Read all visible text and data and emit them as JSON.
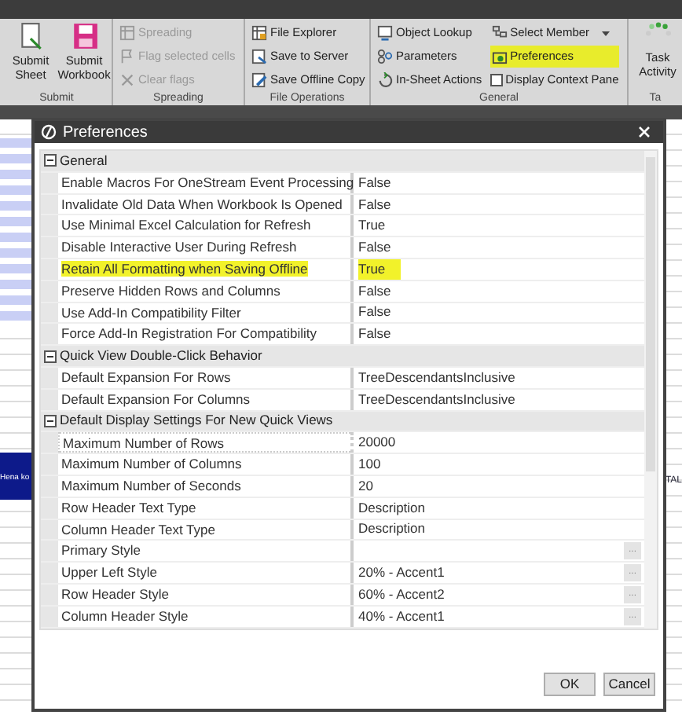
{
  "ribbon": {
    "groups": [
      {
        "label": "Submit",
        "kind": "large",
        "items": [
          {
            "label": "Submit Sheet",
            "disabled": false
          },
          {
            "label": "Submit Workbook",
            "disabled": false
          }
        ]
      },
      {
        "label": "Spreading",
        "kind": "small",
        "items": [
          {
            "label": "Spreading",
            "disabled": true
          },
          {
            "label": "Flag selected cells",
            "disabled": true
          },
          {
            "label": "Clear flags",
            "disabled": true
          }
        ]
      },
      {
        "label": "File Operations",
        "kind": "small",
        "items": [
          {
            "label": "File Explorer",
            "disabled": false
          },
          {
            "label": "Save to Server",
            "disabled": false
          },
          {
            "label": "Save Offline Copy",
            "disabled": false
          }
        ]
      },
      {
        "label": "General",
        "kind": "columns",
        "columns": [
          [
            {
              "label": "Object Lookup",
              "kind": "button",
              "highlighted": false
            },
            {
              "label": "Parameters",
              "kind": "button",
              "highlighted": false
            },
            {
              "label": "In-Sheet Actions",
              "kind": "button",
              "highlighted": false
            }
          ],
          [
            {
              "label": "Select Member",
              "kind": "dropdown",
              "highlighted": false
            },
            {
              "label": "Preferences",
              "kind": "button",
              "highlighted": true
            },
            {
              "label": "Display Context Pane",
              "kind": "checkbox",
              "checked": false
            }
          ]
        ]
      },
      {
        "label": "Ta",
        "kind": "large",
        "items": [
          {
            "label": "Task Activity",
            "disabled": false
          }
        ]
      }
    ]
  },
  "sheet": {
    "left_text": "Hena ko",
    "right_text": "TAL"
  },
  "dialog": {
    "title": "Preferences",
    "rows": [
      {
        "kind": "category",
        "label": "General",
        "expanded": true
      },
      {
        "kind": "property",
        "name": "Enable Macros For OneStream Event Processing",
        "value": "False",
        "highlighted": false
      },
      {
        "kind": "property",
        "name": "Invalidate Old Data When Workbook Is Opened",
        "value": "False",
        "highlighted": false
      },
      {
        "kind": "property",
        "name": "Use Minimal Excel Calculation for Refresh",
        "value": "True",
        "highlighted": false
      },
      {
        "kind": "property",
        "name": "Disable Interactive User During Refresh",
        "value": "False",
        "highlighted": false
      },
      {
        "kind": "property",
        "name": "Retain All Formatting when Saving Offline",
        "value": "True",
        "highlighted": true
      },
      {
        "kind": "property",
        "name": "Preserve Hidden Rows and Columns",
        "value": "False",
        "highlighted": false
      },
      {
        "kind": "property",
        "name": "Use Add-In Compatibility Filter",
        "value": "False",
        "highlighted": false
      },
      {
        "kind": "property",
        "name": "Force Add-In Registration For Compatibility",
        "value": "False",
        "highlighted": false
      },
      {
        "kind": "category",
        "label": "Quick View Double-Click Behavior",
        "expanded": true
      },
      {
        "kind": "property",
        "name": "Default Expansion For Rows",
        "value": "TreeDescendantsInclusive",
        "highlighted": false
      },
      {
        "kind": "property",
        "name": "Default Expansion For Columns",
        "value": "TreeDescendantsInclusive",
        "highlighted": false
      },
      {
        "kind": "category",
        "label": "Default Display Settings For New Quick Views",
        "expanded": true
      },
      {
        "kind": "property",
        "name": "Maximum Number of Rows",
        "value": "20000",
        "highlighted": false,
        "focused": true
      },
      {
        "kind": "property",
        "name": "Maximum Number of Columns",
        "value": "100",
        "highlighted": false
      },
      {
        "kind": "property",
        "name": "Maximum Number of Seconds",
        "value": "20",
        "highlighted": false
      },
      {
        "kind": "property",
        "name": "Row Header Text Type",
        "value": "Description",
        "highlighted": false
      },
      {
        "kind": "property",
        "name": "Column Header Text Type",
        "value": "Description",
        "highlighted": false
      },
      {
        "kind": "property",
        "name": "Primary Style",
        "button": "...",
        "highlighted": false
      },
      {
        "kind": "property",
        "name": "Upper Left Style",
        "value": "20% - Accent1",
        "button": "...",
        "highlighted": false
      },
      {
        "kind": "property",
        "name": "Row Header Style",
        "value": "60% - Accent2",
        "button": "...",
        "highlighted": false
      },
      {
        "kind": "property",
        "name": "Column Header Style",
        "value": "40% - Accent1",
        "button": "...",
        "highlighted": false
      }
    ],
    "buttons": [
      "OK",
      "Cancel"
    ]
  }
}
